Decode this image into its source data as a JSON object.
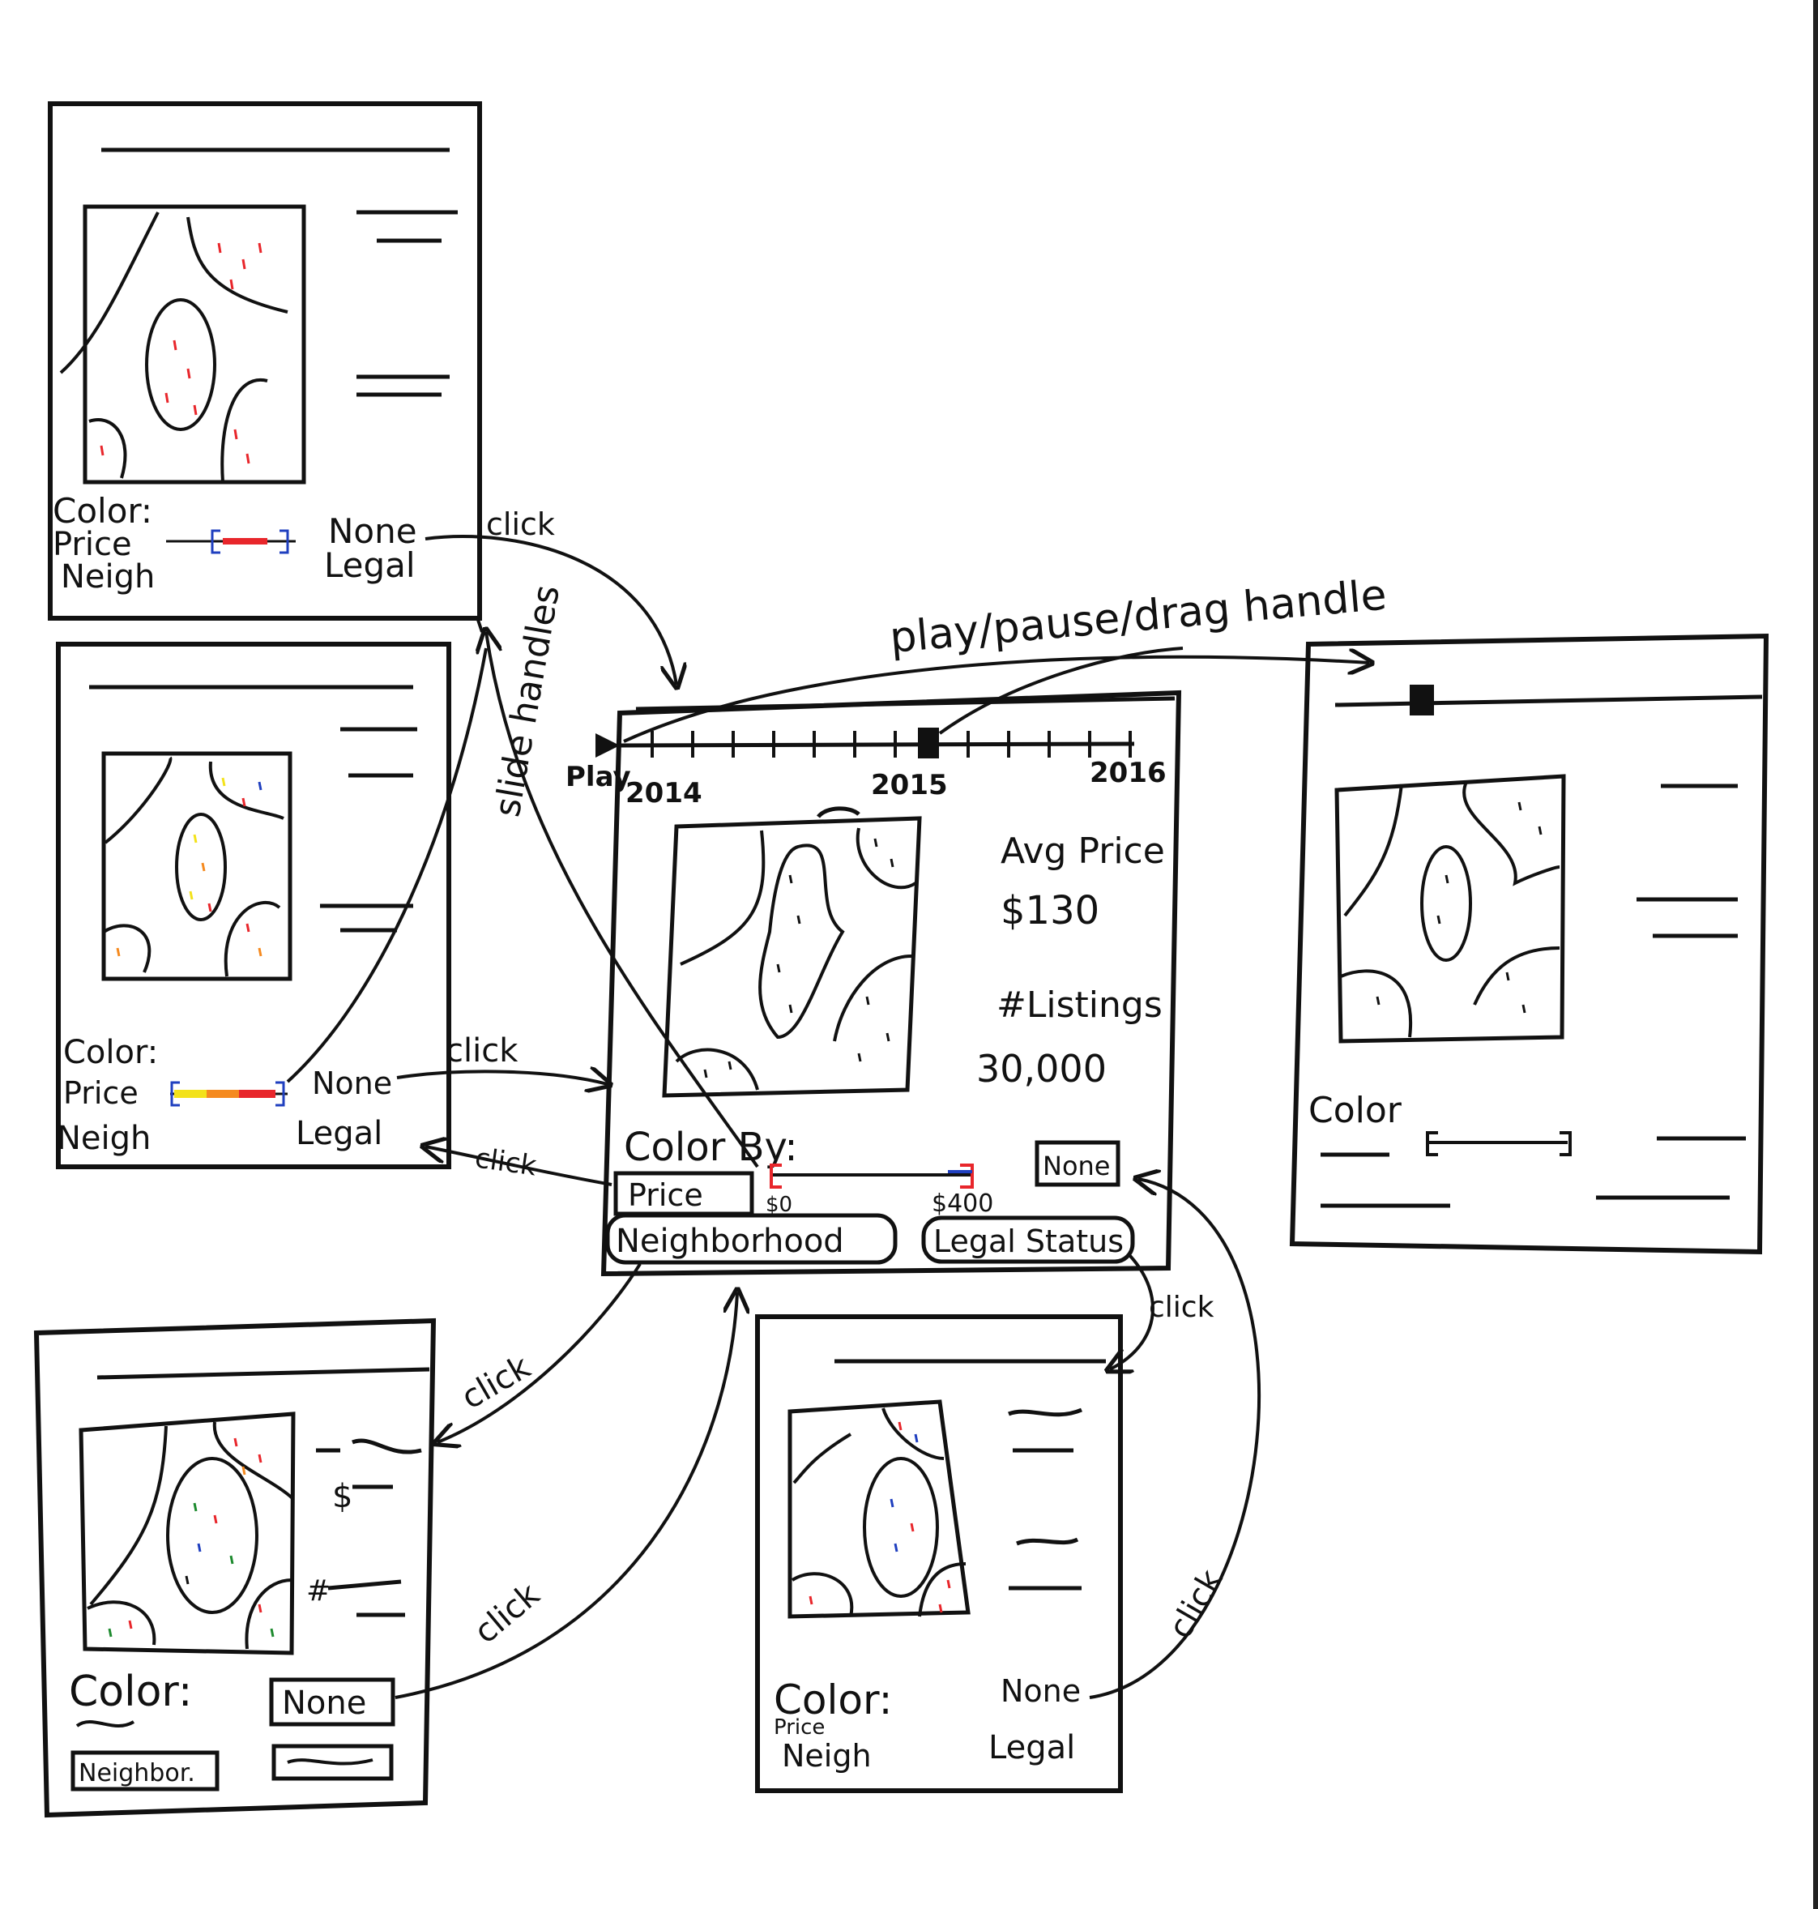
{
  "annotations": {
    "play_pause": "play/pause/drag handle",
    "slide_handles": "slide handles",
    "click": "click"
  },
  "main": {
    "play_label": "Play",
    "years": [
      "2014",
      "2015",
      "2016"
    ],
    "avg_price_label": "Avg Price",
    "avg_price_value": "$130",
    "listings_label": "#Listings",
    "listings_value": "30,000",
    "color_by_label": "Color By:",
    "price_button": "Price",
    "range_min": "$0",
    "range_max": "$400",
    "none_button": "None",
    "neighborhood_button": "Neighborhood",
    "legal_status_button": "Legal Status"
  },
  "frame_top_left": {
    "color": "Color:",
    "price": "Price",
    "neigh": "Neigh",
    "none": "None",
    "legal": "Legal"
  },
  "frame_mid_left": {
    "color": "Color:",
    "price": "Price",
    "neigh": "Neigh",
    "none": "None",
    "legal": "Legal"
  },
  "frame_bottom_left": {
    "color": "Color:",
    "none": "None",
    "neighbor": "Neighbor.",
    "dollar": "$",
    "hash": "#"
  },
  "frame_bottom_center": {
    "color": "Color:",
    "price": "Price",
    "neigh": "Neigh",
    "none": "None",
    "legal": "Legal"
  },
  "frame_right": {
    "color": "Color"
  },
  "colors": {
    "ink": "#111111",
    "red": "#e8262b",
    "orange": "#f58a1f",
    "yellow": "#f3e21a",
    "green": "#1d8a2e",
    "blue": "#1f3fbf"
  }
}
